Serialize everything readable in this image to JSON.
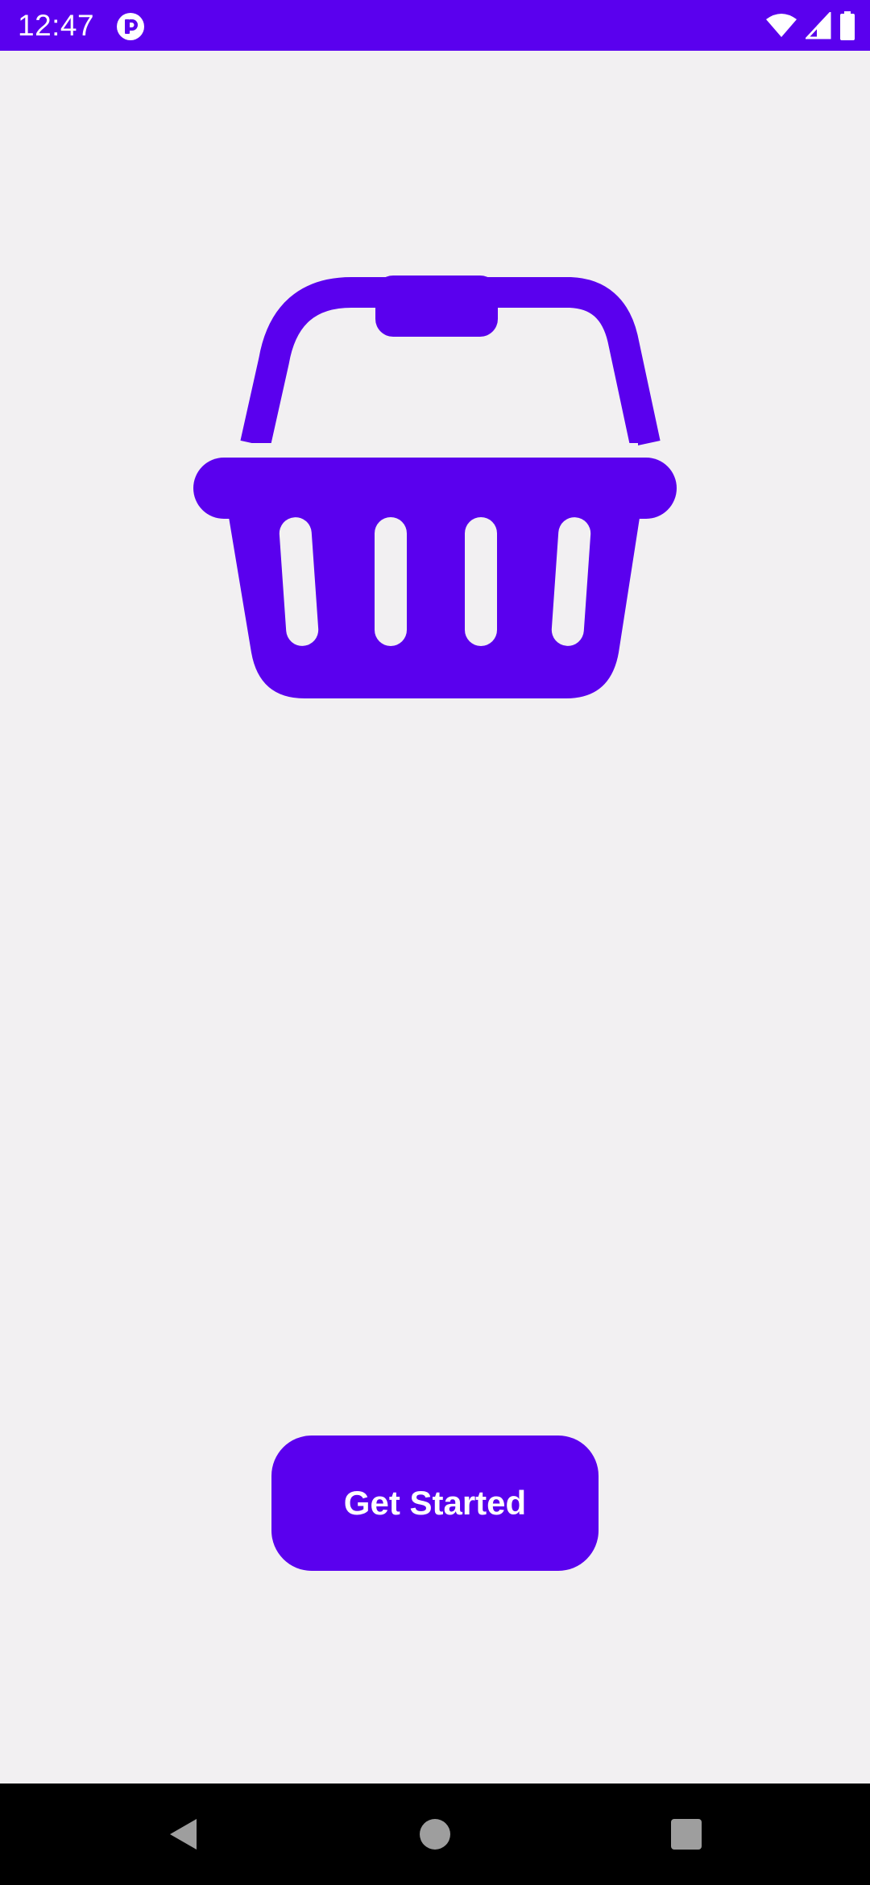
{
  "status_bar": {
    "time": "12:47",
    "icons": [
      "app-notification-icon",
      "wifi-icon",
      "signal-icon",
      "battery-icon"
    ],
    "background_color": "#5a00ee"
  },
  "main": {
    "logo_icon": "shopping-basket-icon",
    "accent_color": "#5a00ee",
    "background_color": "#f2f0f2",
    "get_started_label": "Get Started"
  },
  "nav_bar": {
    "icons": [
      "back-icon",
      "home-icon",
      "recents-icon"
    ]
  }
}
